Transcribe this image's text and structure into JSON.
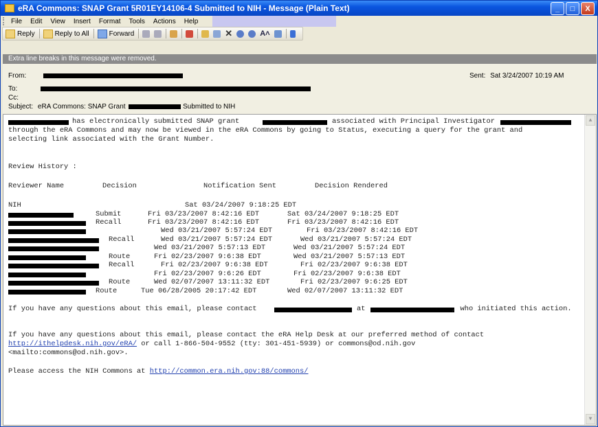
{
  "window": {
    "title": "eRA Commons: SNAP Grant 5R01EY14106-4 Submitted to NIH - Message (Plain Text)",
    "btn_min": "_",
    "btn_max": "□",
    "btn_close": "X"
  },
  "menu": [
    "File",
    "Edit",
    "View",
    "Insert",
    "Format",
    "Tools",
    "Actions",
    "Help"
  ],
  "toolbar": {
    "reply": "Reply",
    "reply_all": "Reply to All",
    "forward": "Forward"
  },
  "infobar": "Extra line breaks in this message were removed.",
  "header": {
    "from_label": "From:",
    "to_label": "To:",
    "cc_label": "Cc:",
    "subject_label": "Subject:",
    "subject_prefix": "eRA Commons: SNAP Grant",
    "subject_suffix": "Submitted to NIH",
    "sent_label": "Sent:",
    "sent_value": "Sat 3/24/2007 10:19 AM"
  },
  "message": {
    "line1_a": "has electronically submitted SNAP grant",
    "line1_b": "associated with Principal Investigator",
    "line2": "through the eRA Commons and may now be viewed in the eRA Commons by going to Status, executing a query for the grant and",
    "line3": "selecting link associated with the Grant Number.",
    "review_history": "Review History :",
    "col_reviewer": "Reviewer Name",
    "col_decision": "Decision",
    "col_notification": "Notification Sent",
    "col_rendered": "Decision Rendered",
    "rows": [
      {
        "reviewer": "NIH",
        "decision": "",
        "notification": "Sat 03/24/2007 9:18:25 EDT",
        "rendered": ""
      },
      {
        "reviewer": "",
        "decision": "Submit",
        "notification": "Fri 03/23/2007 8:42:16 EDT",
        "rendered": "Sat 03/24/2007 9:18:25 EDT"
      },
      {
        "reviewer": "",
        "decision": "Recall",
        "notification": "Fri 03/23/2007 8:42:16 EDT",
        "rendered": "Fri 03/23/2007 8:42:16 EDT"
      },
      {
        "reviewer": "",
        "decision": "",
        "notification": "Wed 03/21/2007 5:57:24 EDT",
        "rendered": "Fri 03/23/2007 8:42:16 EDT"
      },
      {
        "reviewer": "",
        "decision": "Recall",
        "notification": "Wed 03/21/2007 5:57:24 EDT",
        "rendered": "Wed 03/21/2007 5:57:24 EDT"
      },
      {
        "reviewer": "",
        "decision": "",
        "notification": "Wed 03/21/2007 5:57:13 EDT",
        "rendered": "Wed 03/21/2007 5:57:24 EDT"
      },
      {
        "reviewer": "",
        "decision": "Route",
        "notification": "Fri 02/23/2007 9:6:38 EDT",
        "rendered": "Wed 03/21/2007 5:57:13 EDT"
      },
      {
        "reviewer": "",
        "decision": "Recall",
        "notification": "Fri 02/23/2007 9:6:38 EDT",
        "rendered": "Fri 02/23/2007 9:6:38 EDT"
      },
      {
        "reviewer": "",
        "decision": "",
        "notification": "Fri 02/23/2007 9:6:26 EDT",
        "rendered": "Fri 02/23/2007 9:6:38 EDT"
      },
      {
        "reviewer": "",
        "decision": "Route",
        "notification": "Wed 02/07/2007 13:11:32 EDT",
        "rendered": "Fri 02/23/2007 9:6:25 EDT"
      },
      {
        "reviewer": "",
        "decision": "Route",
        "notification": "Tue 06/28/2005 20:17:42 EDT",
        "rendered": "Wed 02/07/2007 13:11:32 EDT"
      }
    ],
    "q1_a": "If you have any questions about this email, please contact",
    "q1_b": "at",
    "q1_c": ", who initiated this action.",
    "q2_line1": "If you have any questions about this email, please contact the eRA Help Desk at our preferred method of contact",
    "q2_link": "http://ithelpdesk.nih.gov/eRA/",
    "q2_rest": " or call 1-866-504-9552 (tty: 301-451-5939) or commons@od.nih.gov",
    "q2_mailto": "<mailto:commons@od.nih.gov>",
    "q2_end": ".",
    "access_text": "Please access the NIH Commons at ",
    "access_link": "http://common.era.nih.gov:88/commons/"
  }
}
